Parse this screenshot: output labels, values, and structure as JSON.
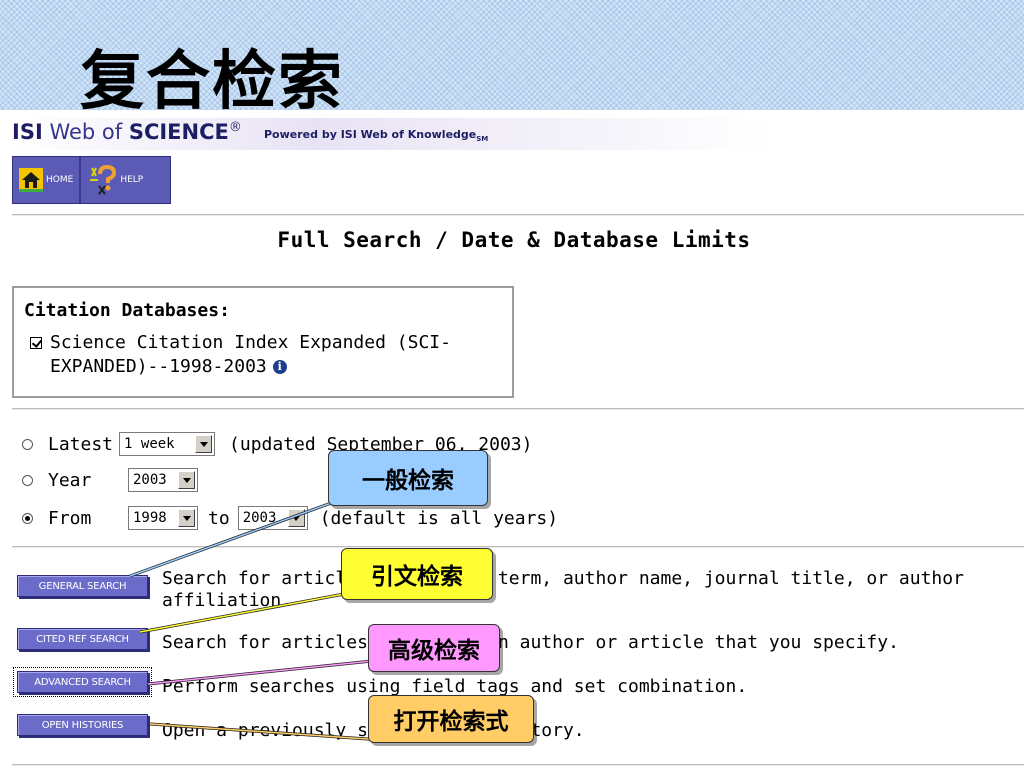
{
  "slide": {
    "title": "复合检索"
  },
  "header": {
    "brand_isi": "ISI",
    "brand_web_of": " Web of ",
    "brand_science": "SCIENCE",
    "brand_reg": "®",
    "powered_by": "Powered by ISI Web of Knowledge",
    "powered_sub": "SM"
  },
  "nav": {
    "home_label": "HOME",
    "help_label": "HELP"
  },
  "page": {
    "heading": "Full Search / Date & Database Limits"
  },
  "citation_databases": {
    "title": "Citation Databases:",
    "checked": true,
    "entry_line1": "Science Citation Index Expanded (SCI-",
    "entry_line2": "EXPANDED)--1998-2003"
  },
  "date_limits": {
    "selected": "From",
    "latest": {
      "label": "Latest",
      "value": "1 week",
      "note": "(updated September 06, 2003)"
    },
    "year": {
      "label": "Year",
      "value": "2003"
    },
    "from": {
      "label": "From",
      "start": "1998",
      "to_label": "to",
      "end": "2003",
      "note": "(default is all years)"
    }
  },
  "searches": [
    {
      "button": "GENERAL SEARCH",
      "line1": "Search for articles by subject term, author name, journal title, or author",
      "line2": "affiliation."
    },
    {
      "button": "CITED REF SEARCH",
      "line1": "Search for articles that cite an author or article that you specify.",
      "line2": ""
    },
    {
      "button": "ADVANCED SEARCH",
      "line1": "Perform searches using field tags and set combination.",
      "line2": ""
    },
    {
      "button": "OPEN HISTORIES",
      "line1": "Open a previously saved search history.",
      "line2": ""
    }
  ],
  "callouts": {
    "general": {
      "text": "一般检索",
      "color": "#99ccff"
    },
    "cited": {
      "text": "引文检索",
      "color": "#ffff33"
    },
    "advanced": {
      "text": "高级检索",
      "color": "#ff99ff"
    },
    "histories": {
      "text": "打开检索式",
      "color": "#ffcc66"
    }
  },
  "colors": {
    "button_bg": "#6b6bc9",
    "nav_bg": "#5b5bb5",
    "brand": "#1d1d63",
    "slide_bg": "#cfe3f8"
  }
}
